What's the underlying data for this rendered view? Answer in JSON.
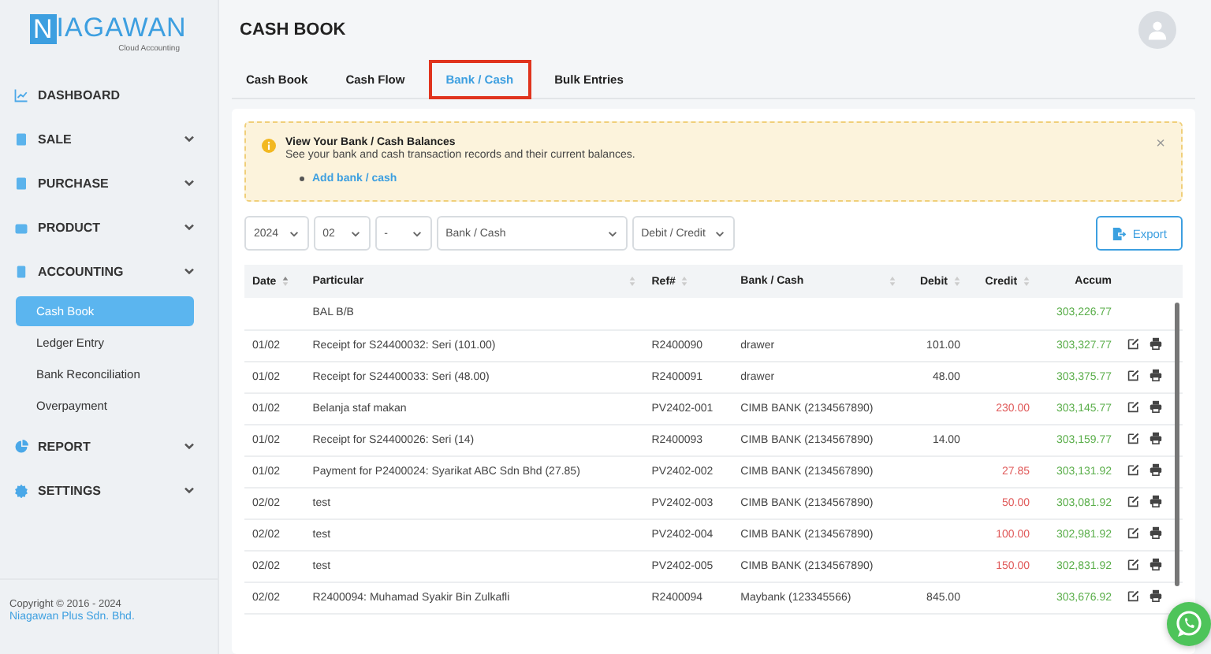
{
  "brand": {
    "logo_first": "N",
    "logo_rest": "IAGAWAN",
    "tagline": "Cloud Accounting"
  },
  "sidebar": {
    "items": [
      {
        "label": "DASHBOARD",
        "kind": "link"
      },
      {
        "label": "SALE",
        "kind": "group"
      },
      {
        "label": "PURCHASE",
        "kind": "group"
      },
      {
        "label": "PRODUCT",
        "kind": "group"
      },
      {
        "label": "ACCOUNTING",
        "kind": "group",
        "children": [
          {
            "label": "Cash Book",
            "selected": true
          },
          {
            "label": "Ledger Entry",
            "selected": false
          },
          {
            "label": "Bank Reconciliation",
            "selected": false
          },
          {
            "label": "Overpayment",
            "selected": false
          }
        ]
      },
      {
        "label": "REPORT",
        "kind": "group"
      },
      {
        "label": "SETTINGS",
        "kind": "group"
      }
    ],
    "copyright": "Copyright © 2016 - 2024",
    "company": "Niagawan Plus Sdn. Bhd."
  },
  "page_title": "CASH BOOK",
  "tabs": [
    {
      "label": "Cash Book",
      "selected": false
    },
    {
      "label": "Cash Flow",
      "selected": false
    },
    {
      "label": "Bank / Cash",
      "selected": true
    },
    {
      "label": "Bulk Entries",
      "selected": false
    }
  ],
  "alert": {
    "title": "View Your Bank / Cash Balances",
    "text": "See your bank and cash transaction records and their current balances.",
    "link": "Add bank / cash",
    "close": "×"
  },
  "filters": [
    {
      "value": "2024",
      "wide": false
    },
    {
      "value": "02",
      "wide": false
    },
    {
      "value": "-",
      "wide": false
    },
    {
      "value": "Bank / Cash",
      "wide": true
    },
    {
      "value": "Debit / Credit",
      "wide": false
    }
  ],
  "export_button": "Export",
  "table": {
    "columns": [
      "Date",
      "Particular",
      "Ref#",
      "Bank / Cash",
      "Debit",
      "Credit",
      "Accum"
    ],
    "rows": [
      {
        "kind": "balance",
        "date": "",
        "particular": "BAL B/B",
        "ref": "",
        "bank": "",
        "debit": "",
        "credit": "",
        "accum": "303,226.77"
      },
      {
        "kind": "entry",
        "date": "01/02",
        "particular": "Receipt for S24400032: Seri (101.00)",
        "ref": "R2400090",
        "bank": "drawer",
        "debit": "101.00",
        "credit": "",
        "accum": "303,327.77"
      },
      {
        "kind": "entry",
        "date": "01/02",
        "particular": "Receipt for S24400033: Seri (48.00)",
        "ref": "R2400091",
        "bank": "drawer",
        "debit": "48.00",
        "credit": "",
        "accum": "303,375.77"
      },
      {
        "kind": "entry",
        "date": "01/02",
        "particular": "Belanja staf makan",
        "ref": "PV2402-001",
        "bank": "CIMB BANK (2134567890)",
        "debit": "",
        "credit": "230.00",
        "accum": "303,145.77"
      },
      {
        "kind": "entry",
        "date": "01/02",
        "particular": "Receipt for S24400026: Seri (14)",
        "ref": "R2400093",
        "bank": "CIMB BANK (2134567890)",
        "debit": "14.00",
        "credit": "",
        "accum": "303,159.77"
      },
      {
        "kind": "entry",
        "date": "01/02",
        "particular": "Payment for P2400024: Syarikat ABC Sdn Bhd (27.85)",
        "ref": "PV2402-002",
        "bank": "CIMB BANK (2134567890)",
        "debit": "",
        "credit": "27.85",
        "accum": "303,131.92"
      },
      {
        "kind": "entry",
        "date": "02/02",
        "particular": "test",
        "ref": "PV2402-003",
        "bank": "CIMB BANK (2134567890)",
        "debit": "",
        "credit": "50.00",
        "accum": "303,081.92"
      },
      {
        "kind": "entry",
        "date": "02/02",
        "particular": "test",
        "ref": "PV2402-004",
        "bank": "CIMB BANK (2134567890)",
        "debit": "",
        "credit": "100.00",
        "accum": "302,981.92"
      },
      {
        "kind": "entry",
        "date": "02/02",
        "particular": "test",
        "ref": "PV2402-005",
        "bank": "CIMB BANK (2134567890)",
        "debit": "",
        "credit": "150.00",
        "accum": "302,831.92"
      },
      {
        "kind": "entry",
        "date": "02/02",
        "particular": "R2400094: Muhamad Syakir Bin Zulkafli",
        "ref": "R2400094",
        "bank": "Maybank (123345566)",
        "debit": "845.00",
        "credit": "",
        "accum": "303,676.92"
      }
    ]
  }
}
